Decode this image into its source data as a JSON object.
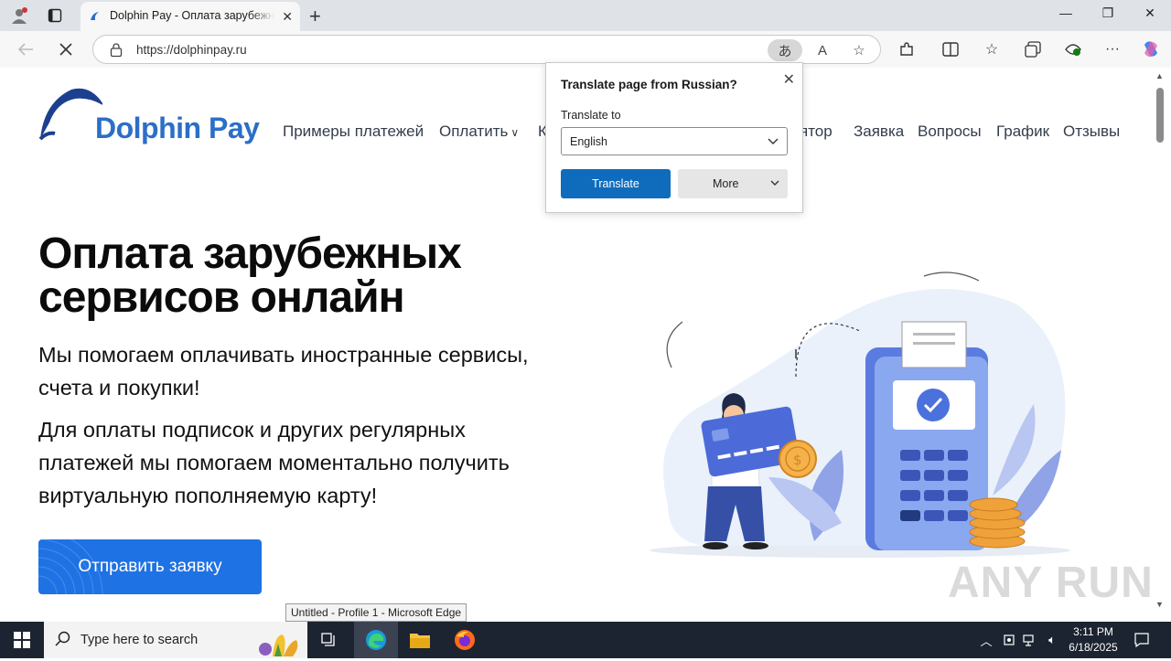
{
  "browser": {
    "tab_title": "Dolphin Pay - Оплата зарубежных сервисов",
    "url": "https://dolphinpay.ru",
    "status_tooltip": "Untitled - Profile 1 - Microsoft Edge"
  },
  "site": {
    "logo_text": "Dolphin Pay",
    "nav": [
      "Примеры платежей",
      "Оплатить",
      "К",
      "ятор",
      "Заявка",
      "Вопросы",
      "График",
      "Отзывы"
    ],
    "headline_line1": "Оплата зарубежных",
    "headline_line2": "сервисов онлайн",
    "para1_line1": "Мы помогаем оплачивать иностранные сервисы,",
    "para1_line2": "счета и покупки!",
    "para2_line1": "Для оплаты подписок и других регулярных",
    "para2_line2": "платежей мы помогаем моментально получить",
    "para2_line3": "виртуальную пополняемую карту!",
    "cta_label": "Отправить заявку"
  },
  "translate_popup": {
    "title": "Translate page from Russian?",
    "label": "Translate to",
    "selected_language": "English",
    "translate_button": "Translate",
    "more_button": "More"
  },
  "watermark": "ANY RUN",
  "taskbar": {
    "search_placeholder": "Type here to search",
    "time": "3:11 PM",
    "date": "6/18/2025"
  },
  "colors": {
    "brand_blue": "#2b6fc7",
    "cta_blue": "#1f72e4",
    "translate_blue": "#0f6cbd"
  }
}
